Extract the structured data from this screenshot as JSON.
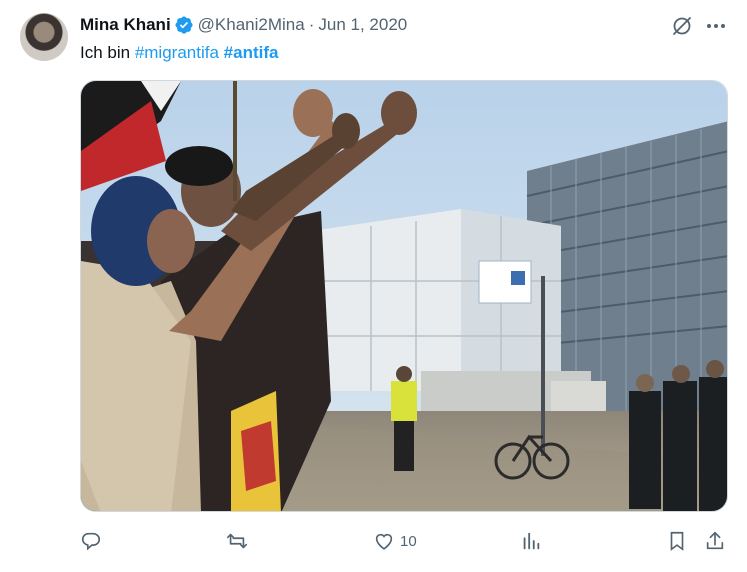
{
  "author": {
    "name": "Mina Khani",
    "handle": "@Khani2Mina",
    "separator": "·",
    "date": "Jun 1, 2020"
  },
  "tweet": {
    "text_prefix": "Ich bin ",
    "hashtag1": "#migrantifa",
    "hashtag2": "#antifa",
    "space": " "
  },
  "actions": {
    "likes": "10"
  },
  "icons": {
    "verified": "verified-badge-icon",
    "grok": "grok-icon",
    "more": "more-icon",
    "reply": "reply-icon",
    "retweet": "retweet-icon",
    "like": "heart-icon",
    "views": "views-icon",
    "bookmark": "bookmark-icon",
    "share": "share-icon"
  },
  "colors": {
    "accent": "#1d9bf0",
    "secondary_text": "#536471",
    "primary_text": "#0f1419"
  }
}
